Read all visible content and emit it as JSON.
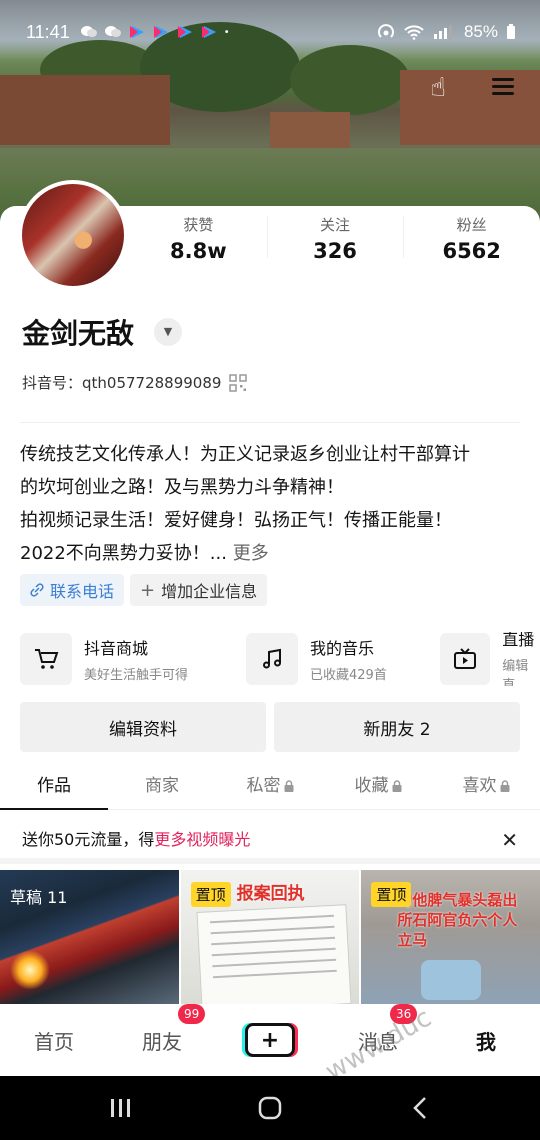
{
  "status_bar": {
    "time": "11:41",
    "battery": "85%"
  },
  "profile": {
    "stats": [
      {
        "label": "获赞",
        "value": "8.8w"
      },
      {
        "label": "关注",
        "value": "326"
      },
      {
        "label": "粉丝",
        "value": "6562"
      }
    ],
    "name": "金剑无敌",
    "douyin_id": "抖音号：qth057728899089",
    "bio": [
      "传统技艺文化传承人！为正义记录返乡创业让村干部算计",
      "的坎坷创业之路！及与黑势力斗争精神！",
      "拍视频记录生活！爱好健身！弘扬正气！传播正能量！",
      "2022不向黑势力妥协！..."
    ],
    "bio_more": "更多",
    "tags": {
      "phone": "联系电话",
      "add_business": "增加企业信息"
    }
  },
  "services": [
    {
      "title": "抖音商城",
      "sub": "美好生活触手可得",
      "icon": "cart-icon"
    },
    {
      "title": "我的音乐",
      "sub": "已收藏429首",
      "icon": "music-note-icon"
    },
    {
      "title": "直播",
      "sub": "编辑直",
      "icon": "tv-icon"
    }
  ],
  "buttons": {
    "edit_profile": "编辑资料",
    "new_friends": "新朋友 2"
  },
  "tabs": [
    {
      "label": "作品",
      "locked": false
    },
    {
      "label": "商家",
      "locked": false
    },
    {
      "label": "私密",
      "locked": true
    },
    {
      "label": "收藏",
      "locked": true
    },
    {
      "label": "喜欢",
      "locked": true
    }
  ],
  "promo": {
    "prefix": "送你50元流量，得",
    "highlight": "更多视频曝光",
    "close": "✕"
  },
  "grid": {
    "draft_label": "草稿 11",
    "pinned_label": "置顶",
    "cell2_overlay": "报案回执",
    "cell3_overlay": "约他脾气暴头磊出所石阿官负六个人立马"
  },
  "bottom_nav": {
    "home": "首页",
    "friends": "朋友",
    "friends_badge": "99",
    "messages": "消息",
    "messages_badge": "36",
    "me": "我"
  },
  "watermark": "www.duc"
}
